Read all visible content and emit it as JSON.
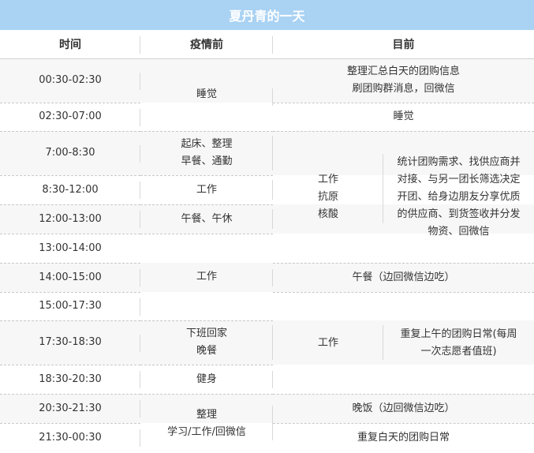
{
  "title": "夏丹青的一天",
  "headers": {
    "time": "时间",
    "before": "疫情前",
    "now": "目前"
  },
  "times": [
    "00:30-02:30",
    "02:30-07:00",
    "7:00-8:30",
    "8:30-12:00",
    "12:00-13:00",
    "13:00-14:00",
    "14:00-15:00",
    "15:00-17:30",
    "17:30-18:30",
    "18:30-20:30",
    "20:30-21:30",
    "21:30-00:30"
  ],
  "before": {
    "sleep": "睡觉",
    "wake_1": "起床、整理",
    "wake_2": "早餐、通勤",
    "work_morning": "工作",
    "lunch": "午餐、午休",
    "work_afternoon": "工作",
    "off_1": "下班回家",
    "off_2": "晚餐",
    "fitness": "健身",
    "night_1": "整理",
    "night_2": "学习/工作/回微信"
  },
  "now": {
    "late_1": "整理汇总白天的团购信息",
    "late_2": "刷团购群消息，回微信",
    "sleep": "睡觉",
    "morning_tag_1": "工作",
    "morning_tag_2": "抗原",
    "morning_tag_3": "核酸",
    "morning_1": "统计团购需求、找供应商并",
    "morning_2": "对接、与另一团长筛选决定",
    "morning_3": "开团、给身边朋友分享优质",
    "morning_4": "的供应商、到货签收并分发",
    "morning_5": "物资、回微信",
    "lunch": "午餐（边回微信边吃）",
    "afternoon_tag": "工作",
    "afternoon_1": "重复上午的团购日常(每周",
    "afternoon_2": "一次志愿者值班)",
    "dinner": "晚饭（边回微信边吃）",
    "night": "重复白天的团购日常"
  }
}
